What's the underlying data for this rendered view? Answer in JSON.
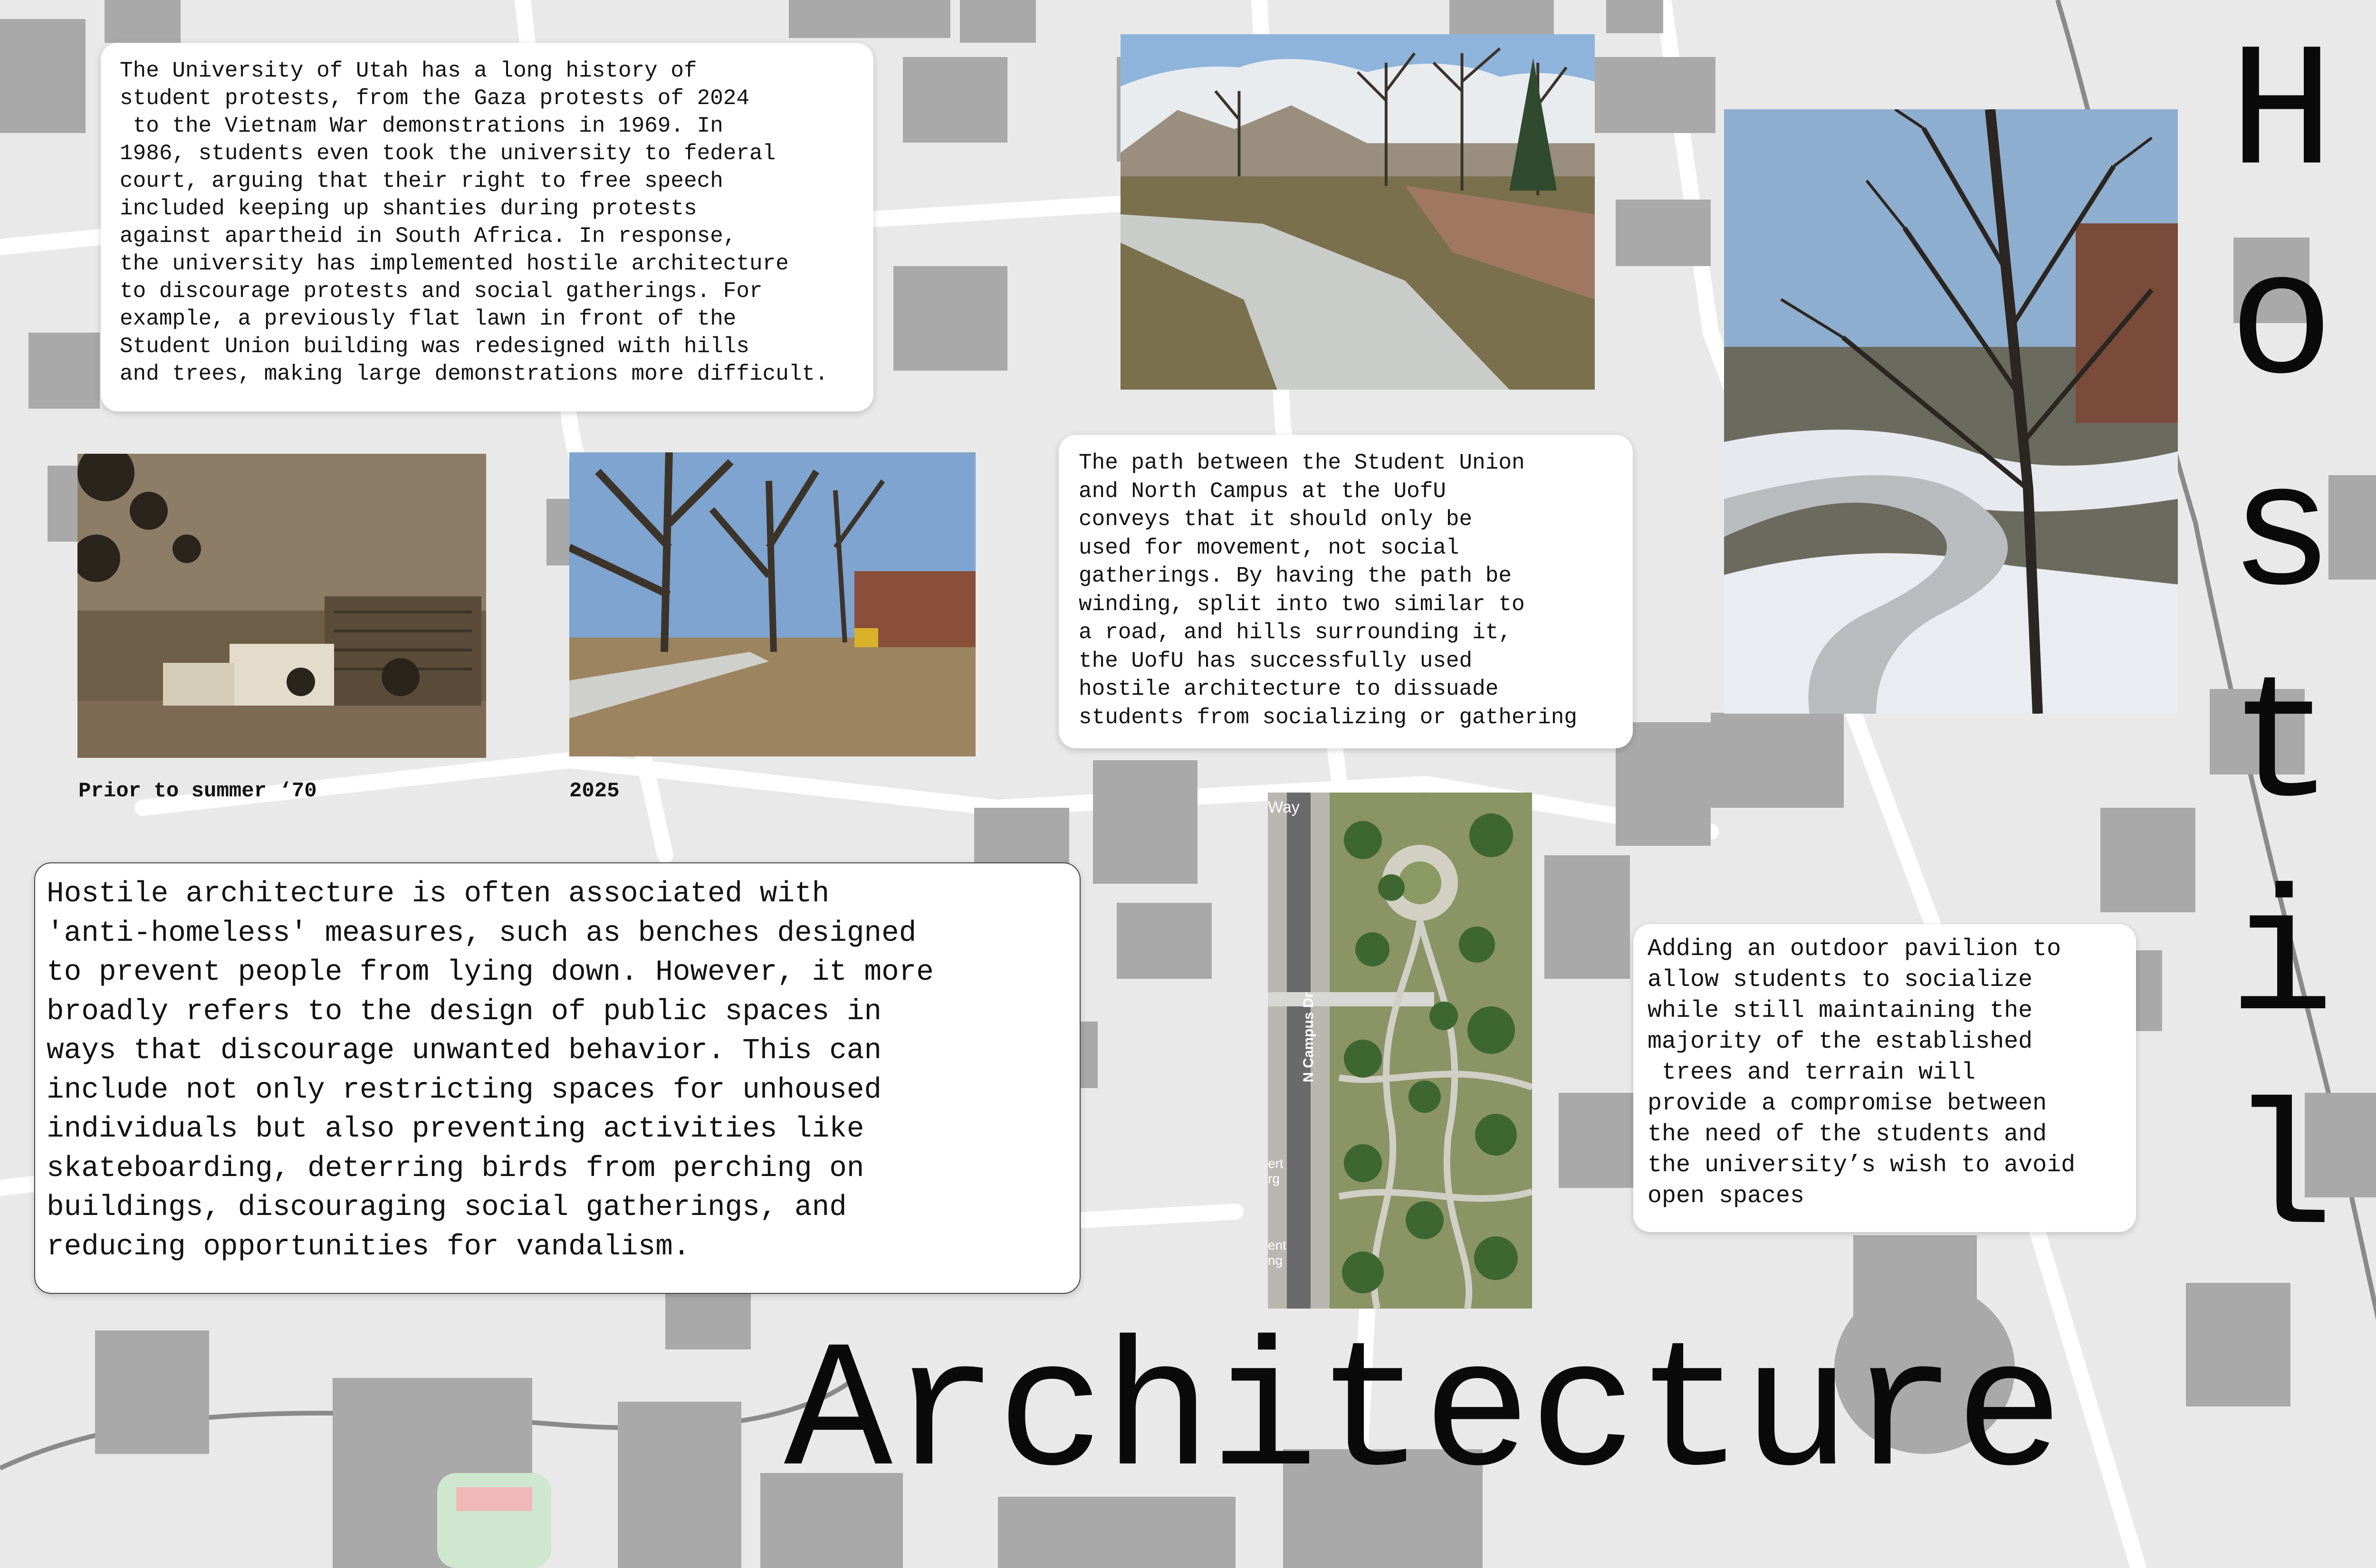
{
  "title": {
    "vertical_word_letters": [
      "H",
      "o",
      "s",
      "t",
      "i",
      "l"
    ],
    "horizontal_word": "Architecture"
  },
  "text_blocks": {
    "history": "The University of Utah has a long history of\nstudent protests, from the Gaza protests of 2024\n to the Vietnam War demonstrations in 1969. In\n1986, students even took the university to federal\ncourt, arguing that their right to free speech\nincluded keeping up shanties during protests\nagainst apartheid in South Africa. In response,\nthe university has implemented hostile architecture\nto discourage protests and social gatherings. For\nexample, a previously flat lawn in front of the\nStudent Union building was redesigned with hills\nand trees, making large demonstrations more difficult.",
    "path": "The path between the Student Union\nand North Campus at the UofU\nconveys that it should only be\nused for movement, not social\ngatherings. By having the path be\nwinding, split into two similar to\na road, and hills surrounding it,\nthe UofU has successfully used\nhostile architecture to dissuade\nstudents from socializing or gathering",
    "definition": "Hostile architecture is often associated with\n'anti-homeless' measures, such as benches designed\nto prevent people from lying down. However, it more\nbroadly refers to the design of public spaces in\nways that discourage unwanted behavior. This can\ninclude not only restricting spaces for unhoused\nindividuals but also preventing activities like\nskateboarding, deterring birds from perching on\nbuildings, discouraging social gatherings, and\nreducing opportunities for vandalism.",
    "proposal": "Adding an outdoor pavilion to\nallow students to socialize\nwhile still maintaining the\nmajority of the established\n trees and terrain will\nprovide a compromise between\nthe need of the students and\nthe university’s wish to avoid\nopen spaces"
  },
  "captions": {
    "before": "Prior to summer ‘70",
    "after": "2025"
  },
  "aerial_map_labels": {
    "street": "N Campus Dr",
    "top_fragment": "Way",
    "left_fragment_1": "ert",
    "left_fragment_2": "rg",
    "left_fragment_3": "ent",
    "left_fragment_4": "ng"
  },
  "colors": {
    "background": "#e9e9e9",
    "map_building": "#a9a9a9",
    "card": "#ffffff",
    "text": "#111111",
    "sepia": "#8b7355"
  }
}
